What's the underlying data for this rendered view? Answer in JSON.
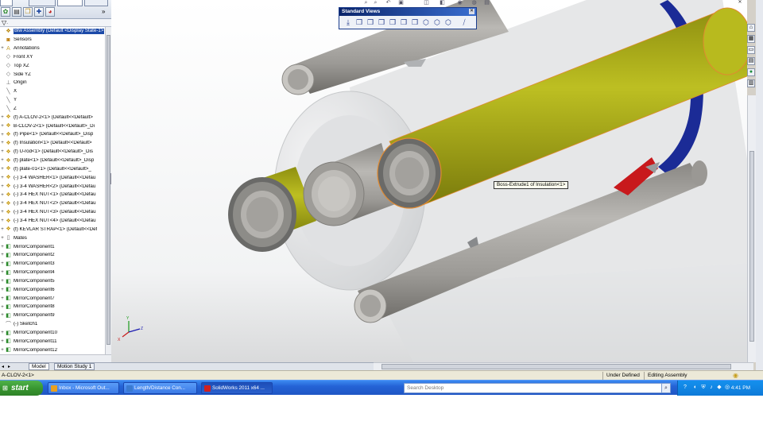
{
  "feature_manager": {
    "filter_icon": "funnel-icon",
    "root": "Blw Assembly  (Default <Display State-1>",
    "items": [
      {
        "label": "Sensors",
        "icon": "sensor-icon",
        "exp": ""
      },
      {
        "label": "Annotations",
        "icon": "annotation-icon",
        "exp": "+"
      },
      {
        "label": "Front XY",
        "icon": "plane-icon",
        "exp": ""
      },
      {
        "label": "Top XZ",
        "icon": "plane-icon",
        "exp": ""
      },
      {
        "label": "Side YZ",
        "icon": "plane-icon",
        "exp": ""
      },
      {
        "label": "Origin",
        "icon": "origin-icon",
        "exp": ""
      },
      {
        "label": "X",
        "icon": "axis-icon",
        "exp": ""
      },
      {
        "label": "Y",
        "icon": "axis-icon",
        "exp": ""
      },
      {
        "label": "Z",
        "icon": "axis-icon",
        "exp": ""
      },
      {
        "label": "(f) A-CLOV-2<1> (Default<<Default>",
        "icon": "part-icon",
        "exp": "+"
      },
      {
        "label": "B-CLOV-2<1> (Default<<Default>_Di",
        "icon": "part-icon",
        "exp": "+"
      },
      {
        "label": "(f) Pipe<1> (Default<<Default>_Disp",
        "icon": "part-icon",
        "exp": "+"
      },
      {
        "label": "(f) Insulation<1> (Default<<Default>",
        "icon": "part-icon",
        "exp": "+"
      },
      {
        "label": "(f) U-rod<1> (Default<<Default>_Dis",
        "icon": "part-icon",
        "exp": "+"
      },
      {
        "label": "(f) plate<1> (Default<<Default>_Disp",
        "icon": "part-icon",
        "exp": "+"
      },
      {
        "label": "(f) plate-01<1> (Default<<Default>_",
        "icon": "part-icon",
        "exp": "+"
      },
      {
        "label": "(-) 3-4 WASHER<1> (Default<<Defau",
        "icon": "part-icon",
        "exp": "+"
      },
      {
        "label": "(-) 3-4 WASHER<2> (Default<<Defau",
        "icon": "part-icon",
        "exp": "+"
      },
      {
        "label": "(-) 3-4 HEX NUT<1> (Default<<Defau",
        "icon": "part-icon",
        "exp": "+"
      },
      {
        "label": "(-) 3-4 HEX NUT<2> (Default<<Defau",
        "icon": "part-icon",
        "exp": "+"
      },
      {
        "label": "(-) 3-4 HEX NUT<3> (Default<<Defau",
        "icon": "part-icon",
        "exp": "+"
      },
      {
        "label": "(-) 3-4 HEX NUT<4> (Default<<Defau",
        "icon": "part-icon",
        "exp": "+"
      },
      {
        "label": "(f) KEVLAR STRAP<1> (Default<<Def",
        "icon": "part-icon",
        "exp": "+"
      },
      {
        "label": "Mates",
        "icon": "mates-icon",
        "exp": "+"
      },
      {
        "label": "MirrorComponent1",
        "icon": "mirror-icon",
        "exp": "+"
      },
      {
        "label": "MirrorComponent2",
        "icon": "mirror-icon",
        "exp": "+"
      },
      {
        "label": "MirrorComponent3",
        "icon": "mirror-icon",
        "exp": "+"
      },
      {
        "label": "MirrorComponent4",
        "icon": "mirror-icon",
        "exp": "+"
      },
      {
        "label": "MirrorComponent5",
        "icon": "mirror-icon",
        "exp": "+"
      },
      {
        "label": "MirrorComponent6",
        "icon": "mirror-icon",
        "exp": "+"
      },
      {
        "label": "MirrorComponent7",
        "icon": "mirror-icon",
        "exp": "+"
      },
      {
        "label": "MirrorComponent8",
        "icon": "mirror-icon",
        "exp": "+"
      },
      {
        "label": "MirrorComponent9",
        "icon": "mirror-icon",
        "exp": "+"
      },
      {
        "label": "(-) Sketch1",
        "icon": "sketch-icon",
        "exp": ""
      },
      {
        "label": "MirrorComponent10",
        "icon": "mirror-icon",
        "exp": "+"
      },
      {
        "label": "MirrorComponent11",
        "icon": "mirror-icon",
        "exp": "+"
      },
      {
        "label": "MirrorComponent12",
        "icon": "mirror-icon",
        "exp": "+"
      }
    ]
  },
  "bottom_tabs": [
    {
      "label": "Model",
      "active": true
    },
    {
      "label": "Motion Study 1",
      "active": false
    }
  ],
  "standard_views": {
    "title": "Standard Views",
    "buttons": [
      "normal-to-icon",
      "front-view-icon",
      "back-view-icon",
      "left-view-icon",
      "right-view-icon",
      "top-view-icon",
      "bottom-view-icon",
      "isometric-icon",
      "trimetric-icon",
      "dimetric-icon",
      "view-selector-icon"
    ]
  },
  "tooltip": "Boss-Extrude1 of Insulation<1>",
  "status_bar": {
    "left": "A-CLOV-2<1>",
    "under_defined": "Under Defined",
    "editing": "Editing Assembly"
  },
  "taskbar": {
    "start": "start",
    "tasks": [
      {
        "label": "Inbox - Microsoft Out...",
        "color": "#e8a020",
        "active": false
      },
      {
        "label": "Length/Distance Con...",
        "color": "#3a7ad0",
        "active": false
      },
      {
        "label": "SolidWorks 2011 x64 ...",
        "color": "#d02020",
        "active": true
      }
    ],
    "search_placeholder": "Search Desktop",
    "clock": "4:41 PM"
  },
  "colors": {
    "insulation": "#b5b71a",
    "pipe": "#a9a7a2",
    "body": "#e8e9ea",
    "strap": "#1b2b96",
    "plate": "#c8191c"
  }
}
